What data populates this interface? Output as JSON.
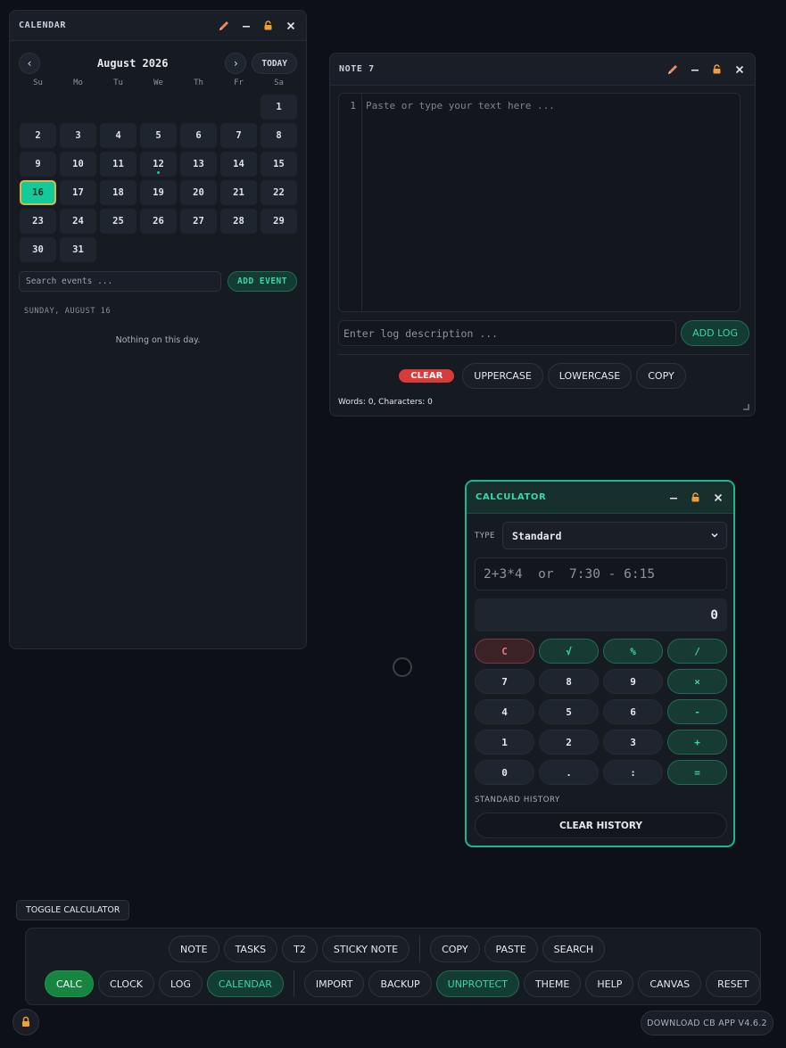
{
  "calendar": {
    "title": "CALENDAR",
    "month_label": "August 2026",
    "prev_label": "‹",
    "next_label": "›",
    "today_label": "TODAY",
    "weekdays": [
      "Su",
      "Mo",
      "Tu",
      "We",
      "Th",
      "Fr",
      "Sa"
    ],
    "leading_blanks": 6,
    "days": [
      "1",
      "2",
      "3",
      "4",
      "5",
      "6",
      "7",
      "8",
      "9",
      "10",
      "11",
      "12",
      "13",
      "14",
      "15",
      "16",
      "17",
      "18",
      "19",
      "20",
      "21",
      "22",
      "23",
      "24",
      "25",
      "26",
      "27",
      "28",
      "29",
      "30",
      "31"
    ],
    "selected_day": "16",
    "event_days": [
      "12"
    ],
    "search_placeholder": "Search events ...",
    "add_event_label": "ADD EVENT",
    "selected_date_label": "SUNDAY, AUGUST 16",
    "empty_message": "Nothing on this day."
  },
  "note": {
    "title": "NOTE 7",
    "line_number": "1",
    "editor_placeholder": "Paste or type your text here ...",
    "log_placeholder": "Enter log description ...",
    "add_log_label": "ADD LOG",
    "actions": {
      "clear": "CLEAR",
      "uppercase": "UPPERCASE",
      "lowercase": "LOWERCASE",
      "copy": "COPY"
    },
    "stats": "Words: 0, Characters: 0"
  },
  "calculator": {
    "title": "CALCULATOR",
    "type_label": "TYPE",
    "type_value": "Standard",
    "expression_placeholder": "2+3*4  or  7:30 - 6:15",
    "result": "0",
    "keys": [
      "C",
      "√",
      "%",
      "/",
      "7",
      "8",
      "9",
      "×",
      "4",
      "5",
      "6",
      "-",
      "1",
      "2",
      "3",
      "+",
      "0",
      ".",
      ":",
      "="
    ],
    "history_label": "STANDARD HISTORY",
    "clear_history_label": "CLEAR HISTORY"
  },
  "toggle_calculator_label": "TOGGLE CALCULATOR",
  "dock": {
    "row1_group1": [
      "NOTE",
      "TASKS",
      "T2",
      "STICKY NOTE"
    ],
    "row1_group2": [
      "COPY",
      "PASTE",
      "SEARCH"
    ],
    "row2_group1": [
      "CALC",
      "CLOCK",
      "LOG",
      "CALENDAR"
    ],
    "row2_group2": [
      "IMPORT",
      "BACKUP",
      "UNPROTECT",
      "THEME",
      "HELP",
      "CANVAS",
      "RESET"
    ]
  },
  "download_label": "DOWNLOAD CB APP  V4.6.2",
  "colors": {
    "background": "#0d1117",
    "accent_teal": "#14c99a",
    "accent_green": "#16853f",
    "danger_red": "#d93a3a",
    "edit_icon_orange": "#f08a5d",
    "lock_icon_orange": "#f0a030"
  },
  "icons": {
    "edit": "pencil-icon",
    "minimize": "minimize-icon",
    "lock": "lock-icon",
    "close": "close-icon",
    "dropdown": "chevron-down-icon"
  }
}
